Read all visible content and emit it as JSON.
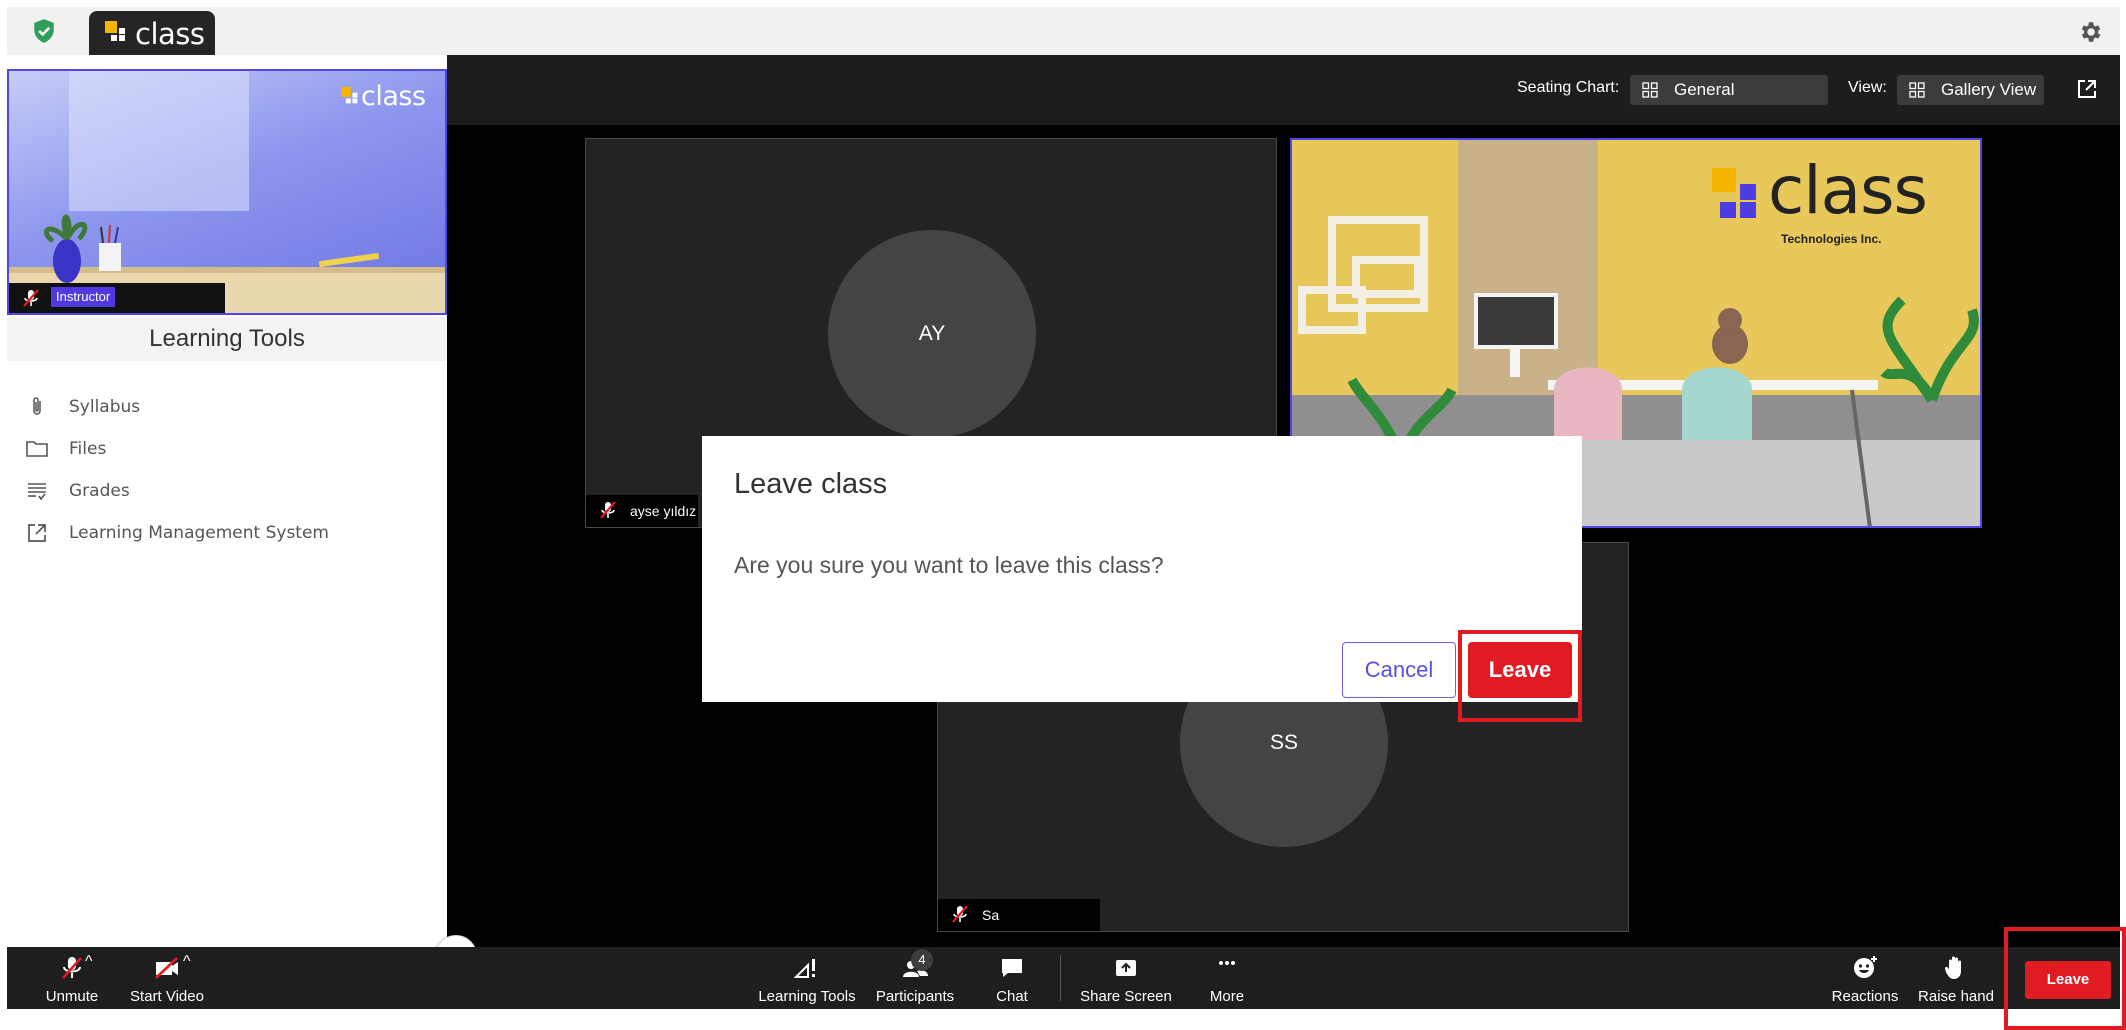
{
  "app": {
    "tab_title": "class"
  },
  "header": {
    "seating_label": "Seating Chart:",
    "seating_value": "General",
    "view_label": "View:",
    "view_value": "Gallery View"
  },
  "instructor": {
    "badge": "Instructor",
    "logo_text": "class"
  },
  "learning_tools": {
    "title": "Learning Tools",
    "items": [
      {
        "label": "Syllabus",
        "icon": "paperclip-icon"
      },
      {
        "label": "Files",
        "icon": "folder-icon"
      },
      {
        "label": "Grades",
        "icon": "grades-list-icon"
      },
      {
        "label": "Learning Management System",
        "icon": "external-link-icon"
      }
    ]
  },
  "tiles": {
    "ay": {
      "initials": "AY",
      "name": "ayse yıldız"
    },
    "ss": {
      "initials": "SS",
      "name": "Sa"
    },
    "office": {
      "brand": "class",
      "brand_sub": "Technologies Inc."
    }
  },
  "dialog": {
    "title": "Leave class",
    "message": "Are you sure you want to leave this class?",
    "cancel": "Cancel",
    "leave": "Leave"
  },
  "toolbar": {
    "unmute": "Unmute",
    "start_video": "Start Video",
    "learning_tools": "Learning Tools",
    "participants": "Participants",
    "participants_count": "4",
    "chat": "Chat",
    "share_screen": "Share Screen",
    "more": "More",
    "reactions": "Reactions",
    "raise_hand": "Raise hand",
    "leave": "Leave"
  },
  "colors": {
    "accent": "#5146e6",
    "leave_red": "#e11b22",
    "logo_yellow": "#f5b400",
    "logo_blue": "#4b3de0"
  }
}
